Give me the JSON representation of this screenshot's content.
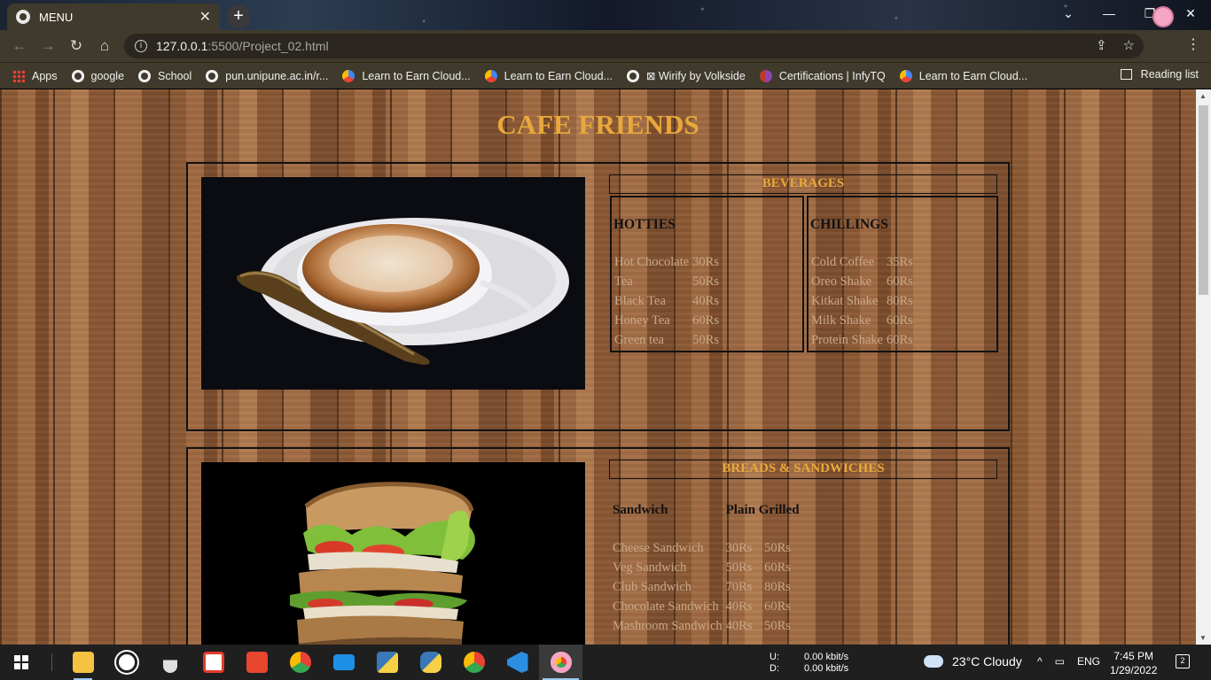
{
  "browser": {
    "tab_title": "MENU",
    "url_host": "127.0.0.1",
    "url_path": ":5500/Project_02.html",
    "bookmarks": [
      "Apps",
      "google",
      "School",
      "pun.unipune.ac.in/r...",
      "Learn to Earn Cloud...",
      "Learn to Earn Cloud...",
      "⊠ Wirify by Volkside",
      "Certifications | InfyTQ",
      "Learn to Earn Cloud..."
    ],
    "reading_list": "Reading list"
  },
  "page": {
    "title": "CAFE FRIENDS",
    "beverages": {
      "heading": "BEVERAGES",
      "hotties": {
        "title": "HOTTIES",
        "items": [
          {
            "name": "Hot Chocolate",
            "price": "30Rs"
          },
          {
            "name": "Tea",
            "price": "50Rs"
          },
          {
            "name": "Black Tea",
            "price": "40Rs"
          },
          {
            "name": "Honey Tea",
            "price": "60Rs"
          },
          {
            "name": "Green tea",
            "price": "50Rs"
          }
        ]
      },
      "chillings": {
        "title": "CHILLINGS",
        "items": [
          {
            "name": "Cold Coffee",
            "price": "35Rs"
          },
          {
            "name": "Oreo Shake",
            "price": "60Rs"
          },
          {
            "name": "Kitkat Shake",
            "price": "80Rs"
          },
          {
            "name": "Milk Shake",
            "price": "60Rs"
          },
          {
            "name": "Protein Shake",
            "price": "60Rs"
          }
        ]
      }
    },
    "breads": {
      "heading": "BREADS & SANDWICHES",
      "col_sandwich": "Sandwich",
      "col_plain_grilled": "Plain Grilled",
      "items": [
        {
          "name": "Cheese Sandwich",
          "plain": "30Rs",
          "grilled": "50Rs"
        },
        {
          "name": "Veg Sandwich",
          "plain": "50Rs",
          "grilled": "60Rs"
        },
        {
          "name": "Club Sandwich",
          "plain": "70Rs",
          "grilled": "80Rs"
        },
        {
          "name": "Chocolate Sandwich",
          "plain": "40Rs",
          "grilled": "60Rs"
        },
        {
          "name": "Mashroom Sandwich",
          "plain": "40Rs",
          "grilled": "50Rs"
        }
      ]
    }
  },
  "taskbar": {
    "net_up_label": "U:",
    "net_down_label": "D:",
    "net_up_value": "0.00 kbit/s",
    "net_down_value": "0.00 kbit/s",
    "weather": "23°C  Cloudy",
    "language": "ENG",
    "time": "7:45 PM",
    "date": "1/29/2022",
    "notification_count": "2"
  },
  "colors": {
    "heading_gold": "#e8a93b",
    "item_text": "#c9a888",
    "chrome": "#3f3a2b"
  }
}
